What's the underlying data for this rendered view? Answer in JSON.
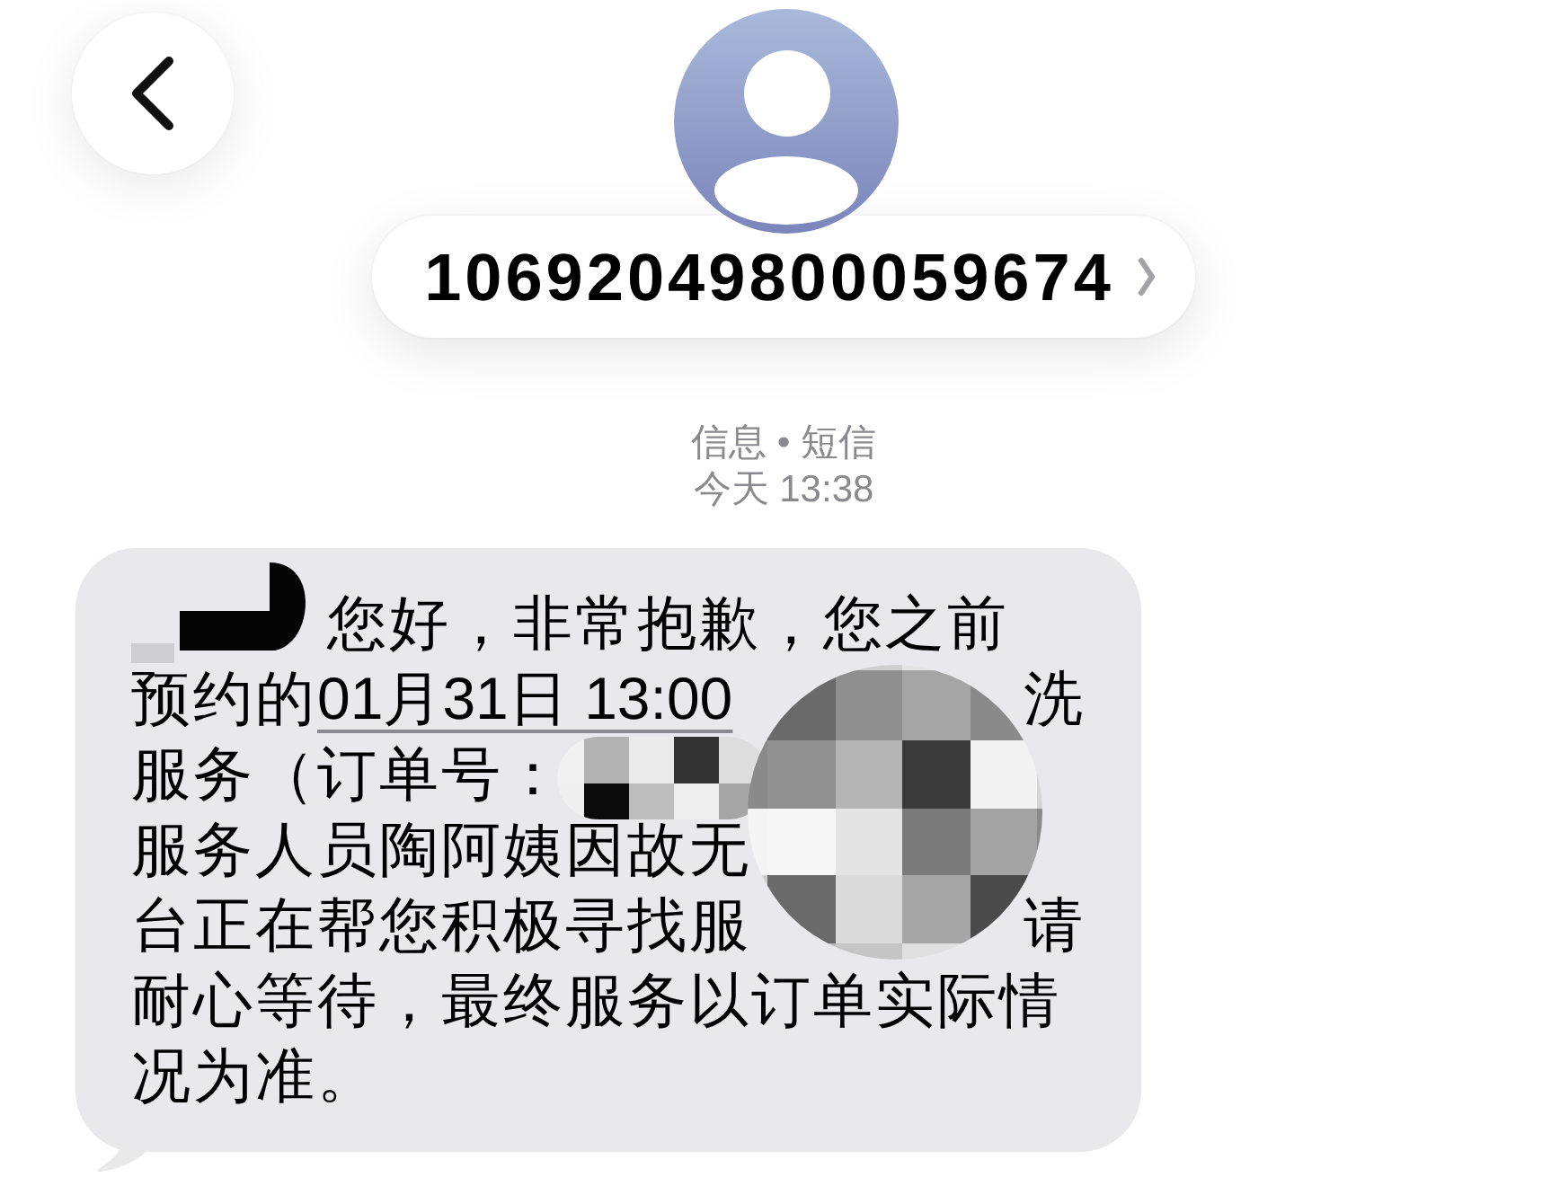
{
  "header": {
    "contact": "10692049800059674"
  },
  "meta": {
    "service": "信息 • 短信",
    "time": "今天 13:38"
  },
  "message": {
    "lines": [
      {
        "parts": [
          {
            "kind": "blot"
          },
          {
            "kind": "text",
            "text": "您好，非常抱歉，您之前"
          }
        ]
      },
      {
        "parts": [
          {
            "kind": "text",
            "text": "预约的"
          },
          {
            "kind": "link",
            "text": "01月31日 13:00"
          },
          {
            "kind": "hidden"
          },
          {
            "kind": "text",
            "text": "洗"
          }
        ]
      },
      {
        "parts": [
          {
            "kind": "text",
            "text": "服务（订单号："
          }
        ]
      },
      {
        "parts": [
          {
            "kind": "text",
            "text": "服务人员陶阿姨因故无"
          }
        ]
      },
      {
        "parts": [
          {
            "kind": "text",
            "text": "台正在帮您积极寻找服"
          },
          {
            "kind": "hidden"
          },
          {
            "kind": "text",
            "text": "请"
          }
        ]
      },
      {
        "parts": [
          {
            "kind": "text",
            "text": "耐心等待，最终服务以订单实际情"
          }
        ]
      },
      {
        "parts": [
          {
            "kind": "text",
            "text": "况为准。"
          }
        ]
      }
    ]
  }
}
